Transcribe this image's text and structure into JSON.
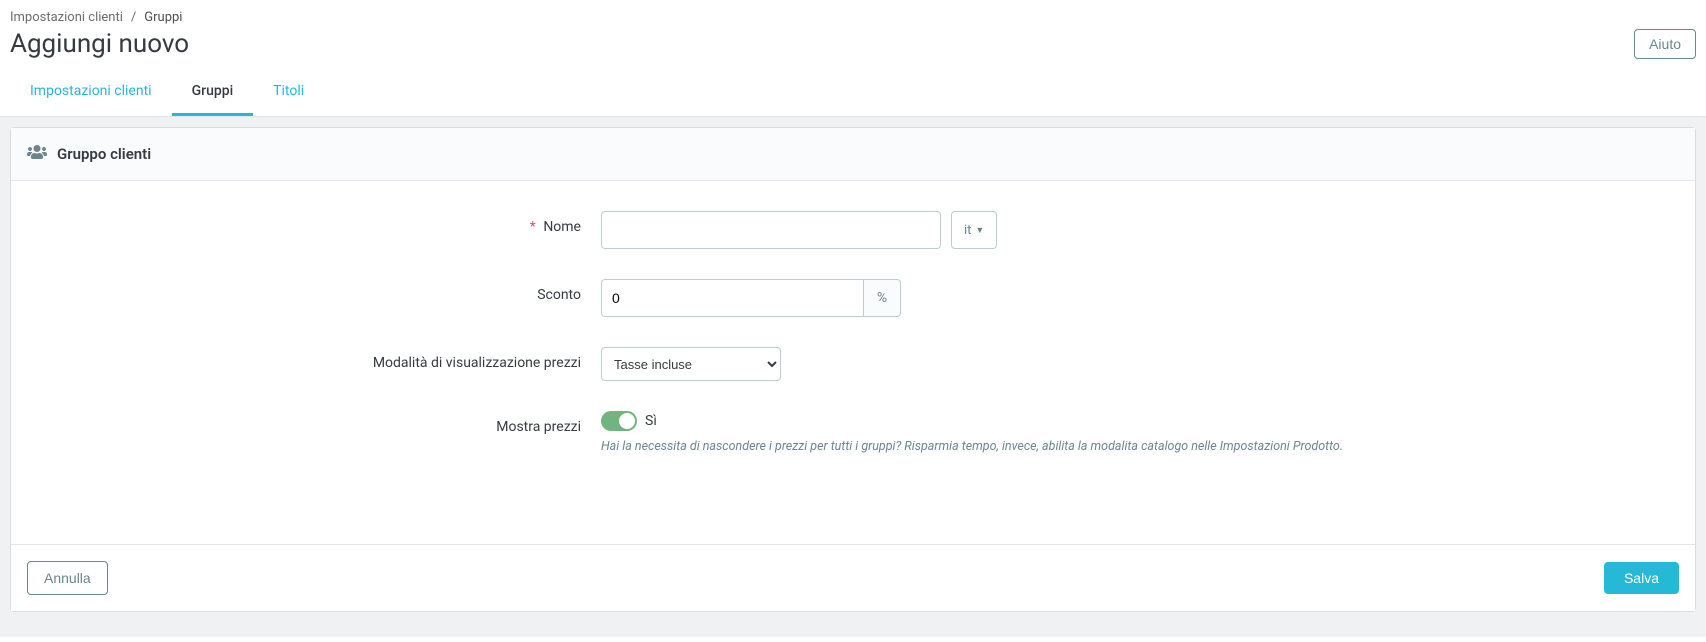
{
  "breadcrumb": {
    "parent": "Impostazioni clienti",
    "current": "Gruppi"
  },
  "page_title": "Aggiungi nuovo",
  "help_button": "Aiuto",
  "tabs": [
    {
      "label": "Impostazioni clienti",
      "active": false
    },
    {
      "label": "Gruppi",
      "active": true
    },
    {
      "label": "Titoli",
      "active": false
    }
  ],
  "panel": {
    "title": "Gruppo clienti"
  },
  "form": {
    "name": {
      "label": "Nome",
      "value": "",
      "lang": "it"
    },
    "discount": {
      "label": "Sconto",
      "value": "0",
      "unit": "%"
    },
    "price_display": {
      "label": "Modalità di visualizzazione prezzi",
      "selected": "Tasse incluse"
    },
    "show_prices": {
      "label": "Mostra prezzi",
      "value_label": "Sì",
      "help": "Hai la necessita di nascondere i prezzi per tutti i gruppi? Risparmia tempo, invece, abilita la modalita catalogo nelle Impostazioni Prodotto."
    }
  },
  "footer": {
    "cancel": "Annulla",
    "save": "Salva"
  }
}
